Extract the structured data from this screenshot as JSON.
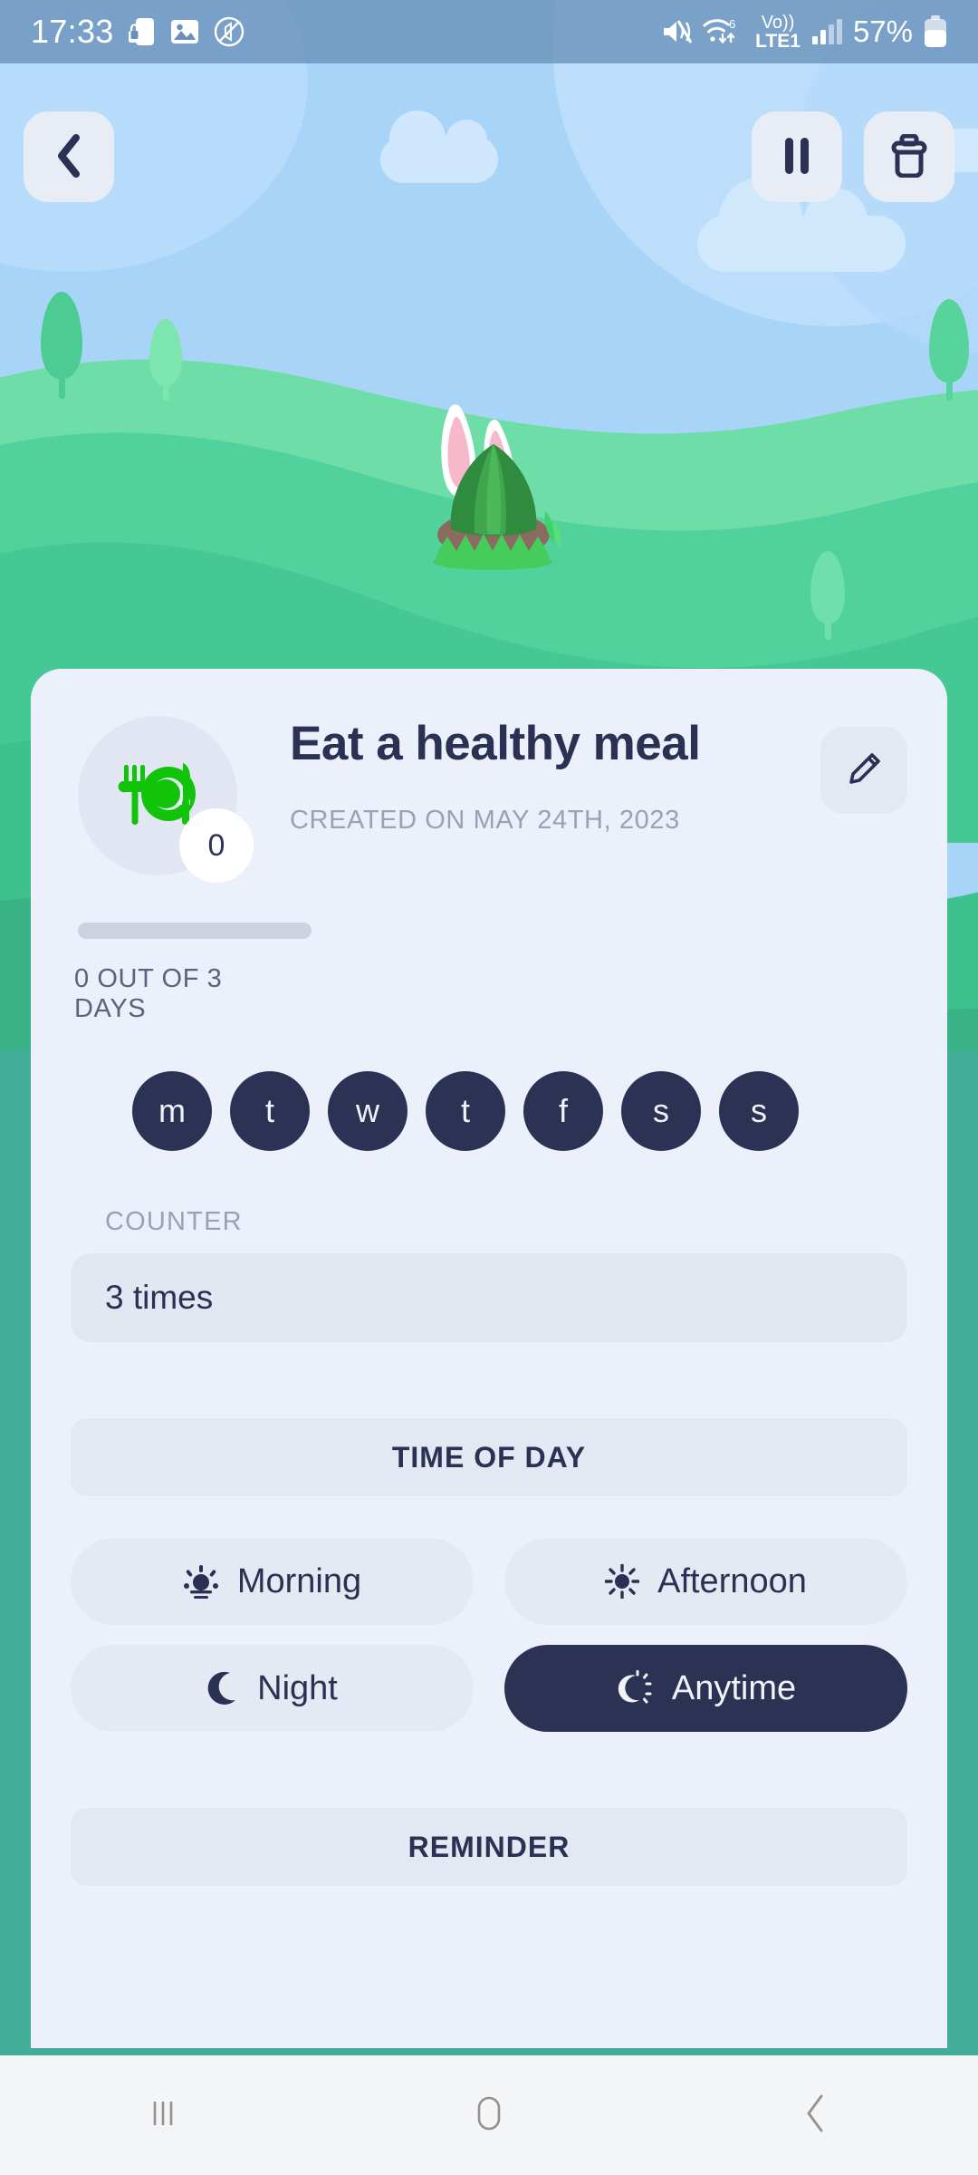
{
  "status_bar": {
    "time": "17:33",
    "battery_percent": "57%",
    "network_label": "LTE1",
    "volte_label": "Vo))",
    "wifi_generation": "6",
    "icons": [
      "phone-lock-icon",
      "image-icon",
      "no-sound-circle-icon",
      "mute-icon",
      "wifi-icon",
      "volte-icon",
      "signal-bars-icon",
      "battery-icon"
    ]
  },
  "top_bar": {
    "back_label": "Back",
    "pause_label": "Pause",
    "delete_label": "Delete"
  },
  "habit": {
    "title": "Eat a healthy meal",
    "created_text": "CREATED ON MAY 24TH, 2023",
    "icon_name": "cutlery-plate-icon",
    "icon_color": "#11C40A",
    "count_badge": "0",
    "progress_label": "0 OUT OF 3 DAYS",
    "progress_percent": 0,
    "edit_label": "Edit"
  },
  "weekdays": [
    {
      "label": "m",
      "name": "monday"
    },
    {
      "label": "t",
      "name": "tuesday"
    },
    {
      "label": "w",
      "name": "wednesday"
    },
    {
      "label": "t",
      "name": "thursday"
    },
    {
      "label": "f",
      "name": "friday"
    },
    {
      "label": "s",
      "name": "saturday"
    },
    {
      "label": "s",
      "name": "sunday"
    }
  ],
  "counter": {
    "label": "COUNTER",
    "value": "3 times"
  },
  "time_of_day": {
    "header": "TIME OF DAY",
    "options": [
      {
        "label": "Morning",
        "icon": "sunrise-icon",
        "selected": false
      },
      {
        "label": "Afternoon",
        "icon": "sun-icon",
        "selected": false
      },
      {
        "label": "Night",
        "icon": "moon-icon",
        "selected": false
      },
      {
        "label": "Anytime",
        "icon": "sun-moon-icon",
        "selected": true
      }
    ]
  },
  "reminder": {
    "header": "REMINDER"
  },
  "nav_bar": {
    "recents_label": "Recents",
    "home_label": "Home",
    "back_label": "Back"
  },
  "colors": {
    "accent_teal": "#41AD99",
    "card_bg": "#EBF0FA",
    "navy": "#2C3254",
    "sky": "#A8D4F7"
  }
}
